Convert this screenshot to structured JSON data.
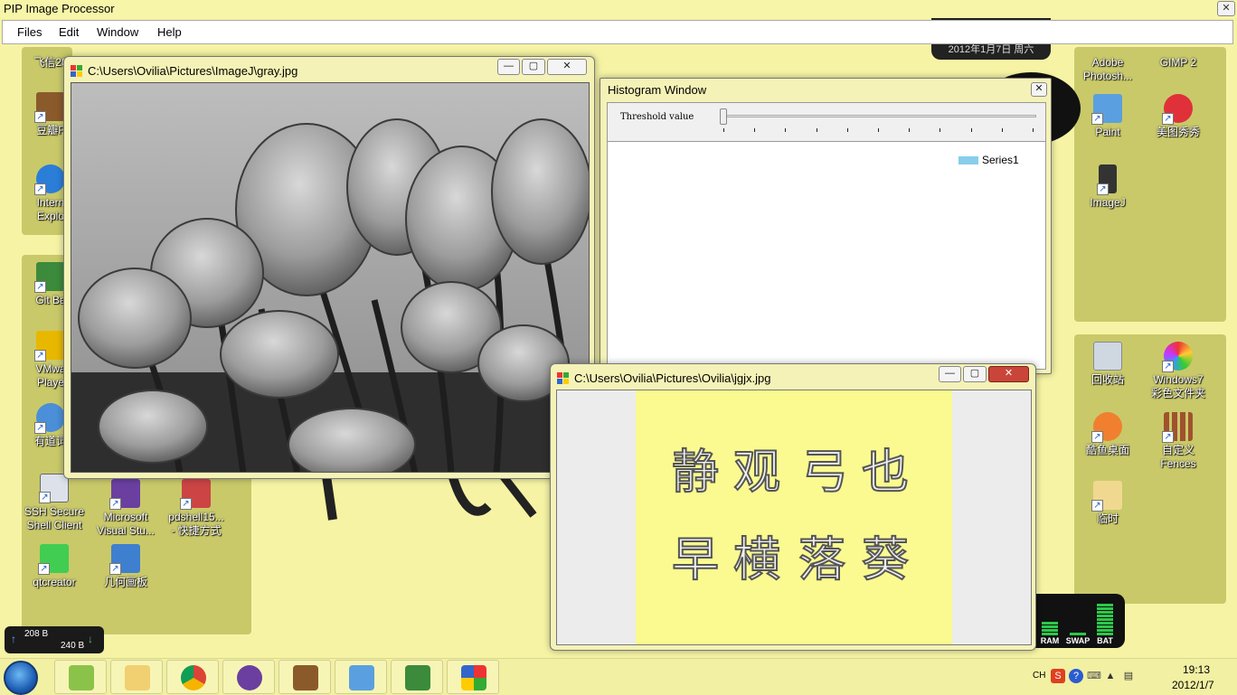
{
  "app": {
    "title": "PIP Image Processor",
    "close_glyph": "✕"
  },
  "menu": [
    "Files",
    "Edit",
    "Window",
    "Help"
  ],
  "desktop": {
    "clock_gadget_text": "2012年1月7日 周六",
    "icons_left": [
      {
        "label": "飞信20"
      },
      {
        "label": "豆瓣F"
      },
      {
        "label": "Intern\nExplo"
      },
      {
        "label": "Git Ba"
      },
      {
        "label": "VMwa\nPlaye"
      },
      {
        "label": "有道词"
      },
      {
        "label": "SSH Secure\nShell Client"
      },
      {
        "label": "Microsoft\nVisual Stu..."
      },
      {
        "label": "pdshell15...\n- 快捷方式"
      },
      {
        "label": "qtcreator"
      },
      {
        "label": "几何画板"
      }
    ],
    "icons_right": [
      {
        "label": "Adobe\nPhotosh..."
      },
      {
        "label": "GIMP 2"
      },
      {
        "label": "Paint"
      },
      {
        "label": "美图秀秀"
      },
      {
        "label": "ImageJ"
      },
      {
        "label": "回收站"
      },
      {
        "label": "Windows7\n彩色文件夹"
      },
      {
        "label": "酷鱼桌面"
      },
      {
        "label": "自定义\nFences"
      },
      {
        "label": "临时"
      }
    ],
    "net_up": "208 B",
    "net_down": "240 B",
    "meters": [
      "RAM",
      "SWAP",
      "BAT"
    ]
  },
  "windows": {
    "gray": {
      "title": "C:\\Users\\Ovilia\\Pictures\\ImageJ\\gray.jpg"
    },
    "histogram": {
      "title": "Histogram Window",
      "threshold_label": "Threshold value",
      "threshold_value": 0,
      "legend": "Series1",
      "legend_color": "#87ceeb"
    },
    "jgjx": {
      "title": "C:\\Users\\Ovilia\\Pictures\\Ovilia\\jgjx.jpg",
      "seal_glyphs": [
        "静",
        "观",
        "弓",
        "也",
        "早",
        "横",
        "落",
        "葵"
      ]
    }
  },
  "taskbar": {
    "buttons": [
      "Notepad++",
      "Windows Explorer",
      "Google Chrome",
      "Visual Studio",
      "豆瓣FM",
      "Paint",
      "Git",
      "PIP Image Processor"
    ],
    "lang": "CH",
    "time": "19:13",
    "date": "2012/1/7"
  },
  "colors": {
    "desktop": "#f6f4a4",
    "fence": "#c9c96a",
    "chart_series": "#87ceeb"
  }
}
